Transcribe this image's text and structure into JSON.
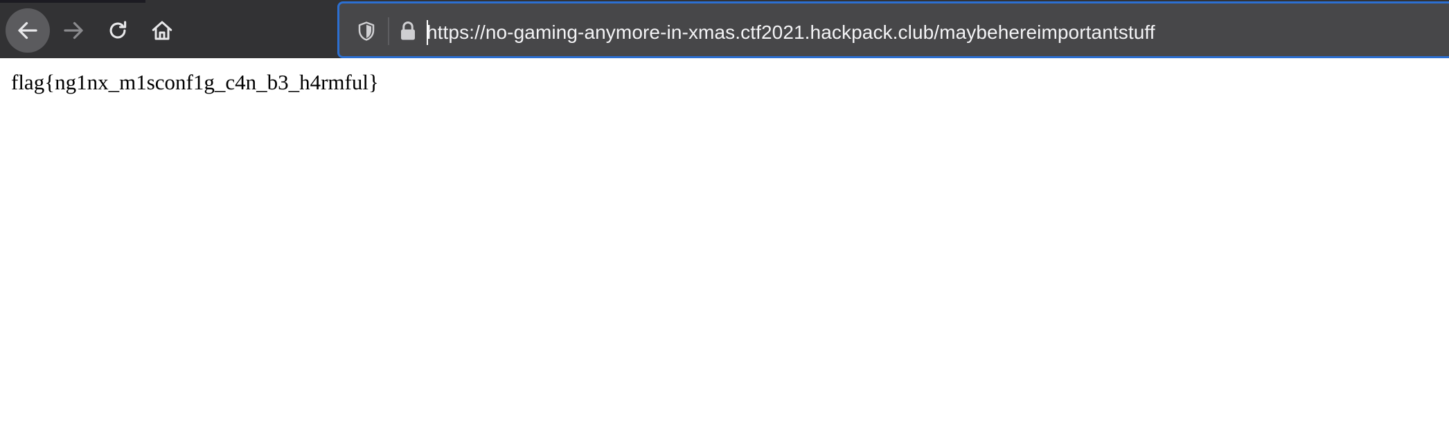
{
  "browser": {
    "nav": {
      "back_icon": "back-arrow-icon",
      "forward_icon": "forward-arrow-icon",
      "reload_icon": "reload-icon",
      "home_icon": "home-icon"
    },
    "urlbar": {
      "url": "https://no-gaming-anymore-in-xmas.ctf2021.hackpack.club/maybehereimportantstuff",
      "tracking_protection_icon": "shield-icon",
      "security_icon": "lock-icon",
      "focus_color": "#2c6fd1"
    },
    "toolbar_color": "#323234"
  },
  "page": {
    "text": "flag{ng1nx_m1sconf1g_c4n_b3_h4rmful}"
  }
}
